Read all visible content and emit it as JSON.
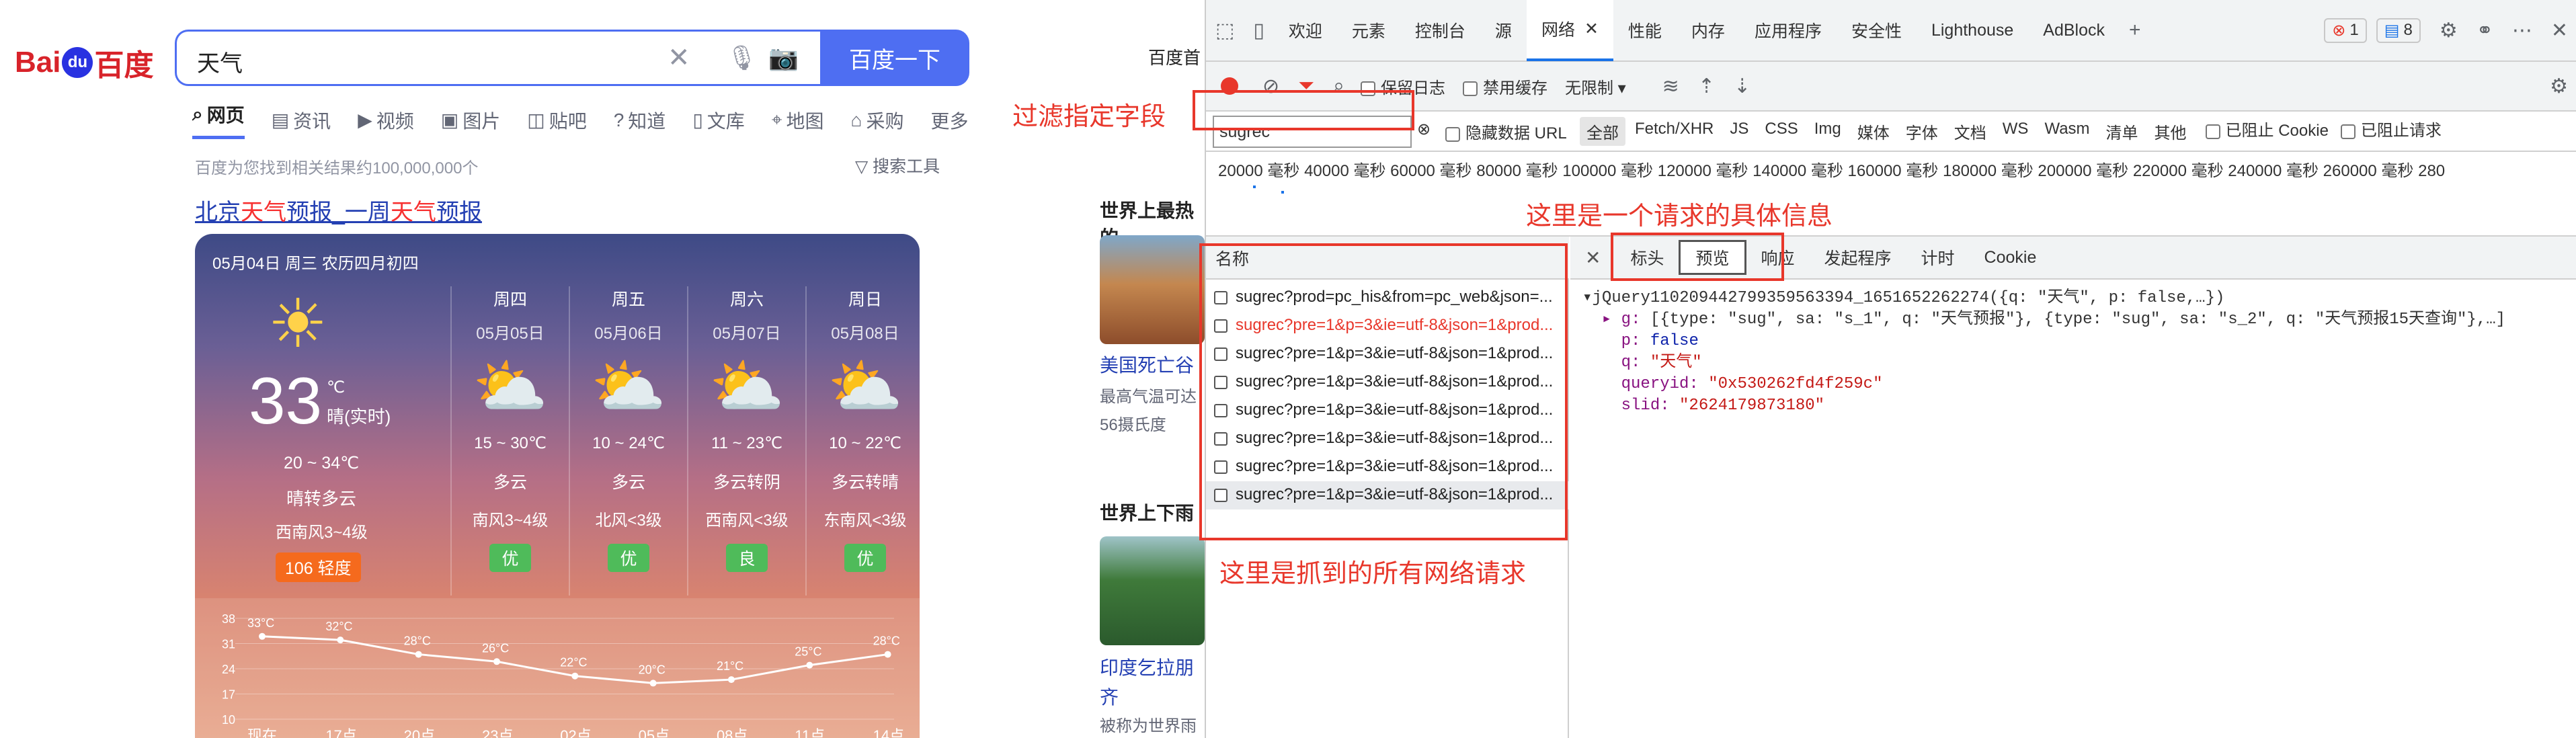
{
  "baidu": {
    "logo_left": "Bai",
    "logo_du": "du",
    "logo_cn": "百度",
    "query": "天气",
    "search_button": "百度一下",
    "home_link": "百度首",
    "tabs": [
      "网页",
      "资讯",
      "视频",
      "图片",
      "贴吧",
      "知道",
      "文库",
      "地图",
      "采购",
      "更多"
    ],
    "result_count": "百度为您找到相关结果约100,000,000个",
    "search_tools": "搜索工具",
    "title_parts": [
      "北京",
      "天气",
      "预报_一周",
      "天气",
      "预报"
    ],
    "weather": {
      "date": "05月04日 周三 农历四月初四",
      "temp": "33",
      "unit": "℃",
      "now": "晴(实时)",
      "range": "20 ~ 34℃",
      "desc": "晴转多云",
      "wind": "西南风3~4级",
      "aqi": "106 轻度",
      "days": [
        {
          "name": "周四",
          "date": "05月05日",
          "range": "15 ~ 30℃",
          "desc": "多云",
          "wind": "南风3~4级",
          "aqi": "优"
        },
        {
          "name": "周五",
          "date": "05月06日",
          "range": "10 ~ 24℃",
          "desc": "多云",
          "wind": "北风<3级",
          "aqi": "优"
        },
        {
          "name": "周六",
          "date": "05月07日",
          "range": "11 ~ 23℃",
          "desc": "多云转阴",
          "wind": "西南风<3级",
          "aqi": "良"
        },
        {
          "name": "周日",
          "date": "05月08日",
          "range": "10 ~ 22℃",
          "desc": "多云转晴",
          "wind": "东南风<3级",
          "aqi": "优"
        }
      ],
      "hourly_temps": [
        "33°C",
        "32°C",
        "28°C",
        "26°C",
        "22°C",
        "20°C",
        "21°C",
        "25°C",
        "28°C"
      ],
      "hourly_times": [
        "现在",
        "17点",
        "20点",
        "23点",
        "02点",
        "05点",
        "08点",
        "11点",
        "14点"
      ],
      "y_ticks": [
        "38",
        "31",
        "24",
        "17",
        "10"
      ]
    },
    "right_col": {
      "h1": "世界上最热的",
      "t1": "美国死亡谷",
      "s1": "最高气温可达",
      "s2": "56摄氏度",
      "h2": "世界上下雨",
      "t2": "印度乞拉朋",
      "t3": "齐",
      "s3": "被称为世界雨"
    },
    "annotations": {
      "filter": "过滤指定字段",
      "detail": "这里是一个请求的具体信息",
      "requests": "这里是抓到的所有网络请求"
    }
  },
  "devtools": {
    "tabs": [
      "欢迎",
      "元素",
      "控制台",
      "源",
      "网络",
      "性能",
      "内存",
      "应用程序",
      "安全性",
      "Lighthouse",
      "AdBlock"
    ],
    "active_tab": "网络",
    "errors_count": "1",
    "messages_count": "8",
    "toolbar": {
      "preserve_log": "保留日志",
      "disable_cache": "禁用缓存",
      "throttle": "无限制"
    },
    "filter": {
      "value": "sugrec",
      "hide_data_url": "隐藏数据 URL",
      "types": [
        "全部",
        "Fetch/XHR",
        "JS",
        "CSS",
        "Img",
        "媒体",
        "字体",
        "文档",
        "WS",
        "Wasm",
        "清单",
        "其他"
      ],
      "blocked_cookies": "已阻止 Cookie",
      "blocked_requests": "已阻止请求"
    },
    "timeline_ticks": "20000 毫秒   40000 毫秒   60000 毫秒   80000 毫秒   100000 毫秒   120000 毫秒   140000 毫秒   160000 毫秒   180000 毫秒   200000 毫秒   220000 毫秒   240000 毫秒   260000 毫秒   280",
    "name_header": "名称",
    "requests": [
      "sugrec?prod=pc_his&from=pc_web&json=...",
      "sugrec?pre=1&p=3&ie=utf-8&json=1&prod...",
      "sugrec?pre=1&p=3&ie=utf-8&json=1&prod...",
      "sugrec?pre=1&p=3&ie=utf-8&json=1&prod...",
      "sugrec?pre=1&p=3&ie=utf-8&json=1&prod...",
      "sugrec?pre=1&p=3&ie=utf-8&json=1&prod...",
      "sugrec?pre=1&p=3&ie=utf-8&json=1&prod...",
      "sugrec?pre=1&p=3&ie=utf-8&json=1&prod..."
    ],
    "detail_tabs": [
      "标头",
      "预览",
      "响应",
      "发起程序",
      "计时",
      "Cookie"
    ],
    "active_detail_tab": "预览",
    "preview": {
      "line1": "▾jQuery110209442799359563394_1651652262274({q: \"天气\", p: false,…})",
      "line2_key": "▸ g:",
      "line2_val": " [{type: \"sug\", sa: \"s_1\", q: \"天气预报\"}, {type: \"sug\", sa: \"s_2\", q: \"天气预报15天查询\"},…]",
      "p_key": "p:",
      "p_val": "false",
      "q_key": "q:",
      "q_val": "\"天气\"",
      "queryid_key": "queryid:",
      "queryid_val": "\"0x530262fd4f259c\"",
      "slid_key": "slid:",
      "slid_val": "\"2624179873180\""
    }
  }
}
